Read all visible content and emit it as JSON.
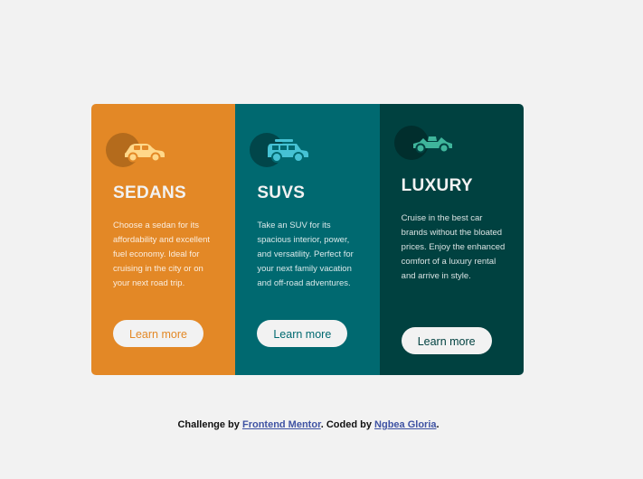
{
  "colors": {
    "page_bg": "#f2f2f2",
    "sedans": "#e38826",
    "suvs": "#006970",
    "luxury": "#004140",
    "link": "#3e52a3"
  },
  "cards": [
    {
      "key": "sedans",
      "icon": "sedan-car-icon",
      "title": "SEDANS",
      "description": "Choose a sedan for its affordability and excellent fuel economy. Ideal for cruising in the city or on your next road trip.",
      "button_label": "Learn more"
    },
    {
      "key": "suvs",
      "icon": "suv-car-icon",
      "title": "SUVS",
      "description": "Take an SUV for its spacious interior, power, and versatility. Perfect for your next family vacation and off-road adventures.",
      "button_label": "Learn more"
    },
    {
      "key": "luxury",
      "icon": "luxury-car-icon",
      "title": "LUXURY",
      "description": "Cruise in the best car brands without the bloated prices. Enjoy the enhanced comfort of a luxury rental and arrive in style.",
      "button_label": "Learn more"
    }
  ],
  "attribution": {
    "prefix": "Challenge by ",
    "link1": "Frontend Mentor",
    "middle": ". Coded by ",
    "link2": "Ngbea Gloria",
    "suffix": "."
  }
}
